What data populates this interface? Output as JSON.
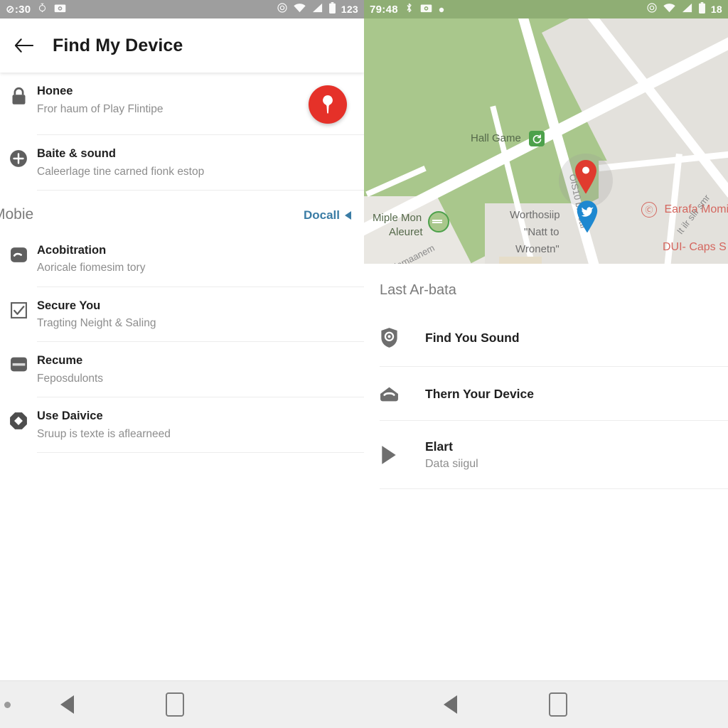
{
  "left_pane": {
    "statusbar": {
      "time": "⊘:30",
      "icons": [
        "alarm-icon",
        "camera-icon"
      ],
      "right_icons": [
        "sync-icon",
        "wifi-icon",
        "signal-icon",
        "battery-icon"
      ],
      "battery": "123"
    },
    "appbar": {
      "back_icon": "back-arrow-icon",
      "title": "Find My Device"
    },
    "items": [
      {
        "icon": "lock-icon",
        "title": "Honee",
        "subtitle": "Fror haum of Play Flintipe",
        "trailing": "location-pin-button"
      },
      {
        "icon": "plus-circle-icon",
        "title": "Baite & sound",
        "subtitle": "Caleerlage tine carned fionk estop"
      }
    ],
    "section": {
      "title": "Mobie",
      "link": "Docall",
      "link_icon": "triangle-left-icon"
    },
    "items2": [
      {
        "icon": "card-rounded-icon",
        "title": "Acobitration",
        "subtitle": "Aoricale fiomesim tory"
      },
      {
        "icon": "checkbox-icon",
        "title": "Secure You",
        "subtitle": "Tragting Neight & Saling"
      },
      {
        "icon": "credit-card-icon",
        "title": "Recume",
        "subtitle": "Feposdulonts"
      },
      {
        "icon": "octagon-diamond-icon",
        "title": "Use Daivice",
        "subtitle": "Sruup is texte is aflearneed"
      }
    ]
  },
  "right_pane": {
    "statusbar": {
      "time": "79:48",
      "icons": [
        "bluetooth-icon",
        "camera-icon",
        "dot-icon"
      ],
      "right_icons": [
        "sync-icon",
        "wifi-icon",
        "signal-icon",
        "battery-icon"
      ],
      "battery": "18"
    },
    "map": {
      "labels": [
        {
          "text": "Hall Game",
          "kind": "park"
        },
        {
          "text": "Miple Mon",
          "kind": "park"
        },
        {
          "text": "Aleuret",
          "kind": "park"
        },
        {
          "text": "Worthosiip",
          "kind": "street"
        },
        {
          "text": "\"Natt to",
          "kind": "street"
        },
        {
          "text": "Wronetn\"",
          "kind": "street"
        },
        {
          "text": "Earafa Momi",
          "kind": "poi"
        },
        {
          "text": "DUI- Caps S",
          "kind": "poi"
        },
        {
          "text": "Niomaanem",
          "kind": "road"
        },
        {
          "text": "OIS10 biolcar",
          "kind": "road"
        },
        {
          "text": "It ilr sllr smr",
          "kind": "road"
        }
      ],
      "pins": [
        "red-location-pin",
        "blue-bird-pin"
      ]
    },
    "section_title": "Last Ar-bata",
    "items": [
      {
        "icon": "shield-icon",
        "title": "Find You Sound",
        "subtitle": ""
      },
      {
        "icon": "lock-arch-icon",
        "title": "Thern Your Device",
        "subtitle": ""
      },
      {
        "icon": "play-triangle-icon",
        "title": "Elart",
        "subtitle": "Data siigul"
      }
    ]
  },
  "navbar": {
    "left": {
      "back": "back-triangle-icon",
      "recents": "square-recents-icon"
    },
    "right": {
      "back": "back-triangle-icon",
      "recents": "square-recents-icon"
    }
  },
  "colors": {
    "accent_red": "#e53129",
    "link_blue": "#3a7ca5",
    "park_green": "#a9c78c",
    "status_left": "#9e9e9e",
    "status_right": "#8fae74"
  }
}
